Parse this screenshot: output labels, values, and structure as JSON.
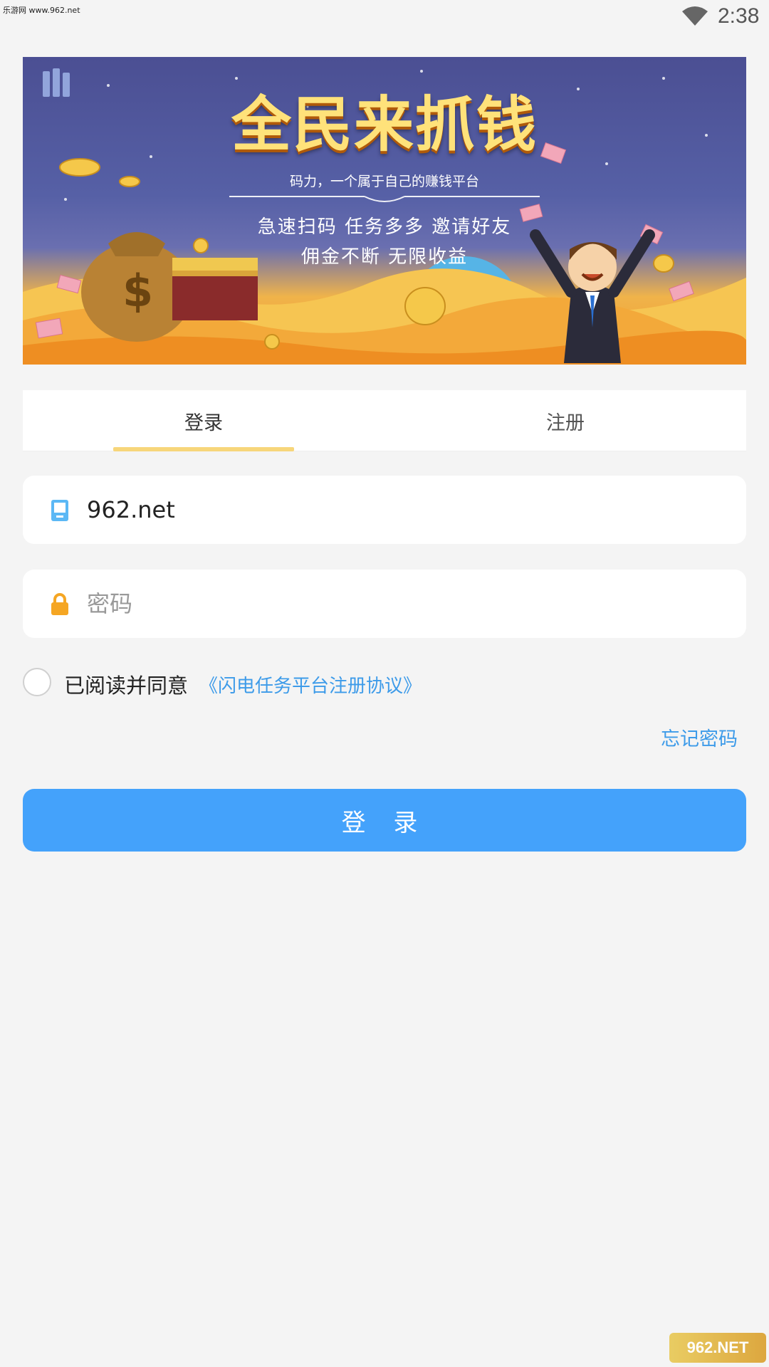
{
  "status_bar": {
    "watermark": "乐游网 www.962.net",
    "time": "2:38",
    "icons": [
      "wifi-icon"
    ]
  },
  "banner": {
    "title": "全民来抓钱",
    "subtitle": "码力，一个属于自己的赚钱平台",
    "line1": "急速扫码  任务多多  邀请好友",
    "line2": "佣金不断  无限收益"
  },
  "tabs": [
    {
      "label": "登录",
      "active": true
    },
    {
      "label": "注册",
      "active": false
    }
  ],
  "form": {
    "account_value": "962.net",
    "account_icon": "phone-icon",
    "password_placeholder": "密码",
    "password_icon": "lock-icon"
  },
  "agreement": {
    "text": "已阅读并同意",
    "link": "《闪电任务平台注册协议》",
    "checked": false
  },
  "forgot_password": "忘记密码",
  "login_button": "登 录",
  "watermark_bottom": "962.NET",
  "colors": {
    "accent_blue": "#44a2fb",
    "link_blue": "#3d9be9",
    "tab_underline": "#f7d67a",
    "lock_orange": "#f5a623",
    "phone_blue": "#5bb8f5",
    "background": "#f4f4f4"
  }
}
